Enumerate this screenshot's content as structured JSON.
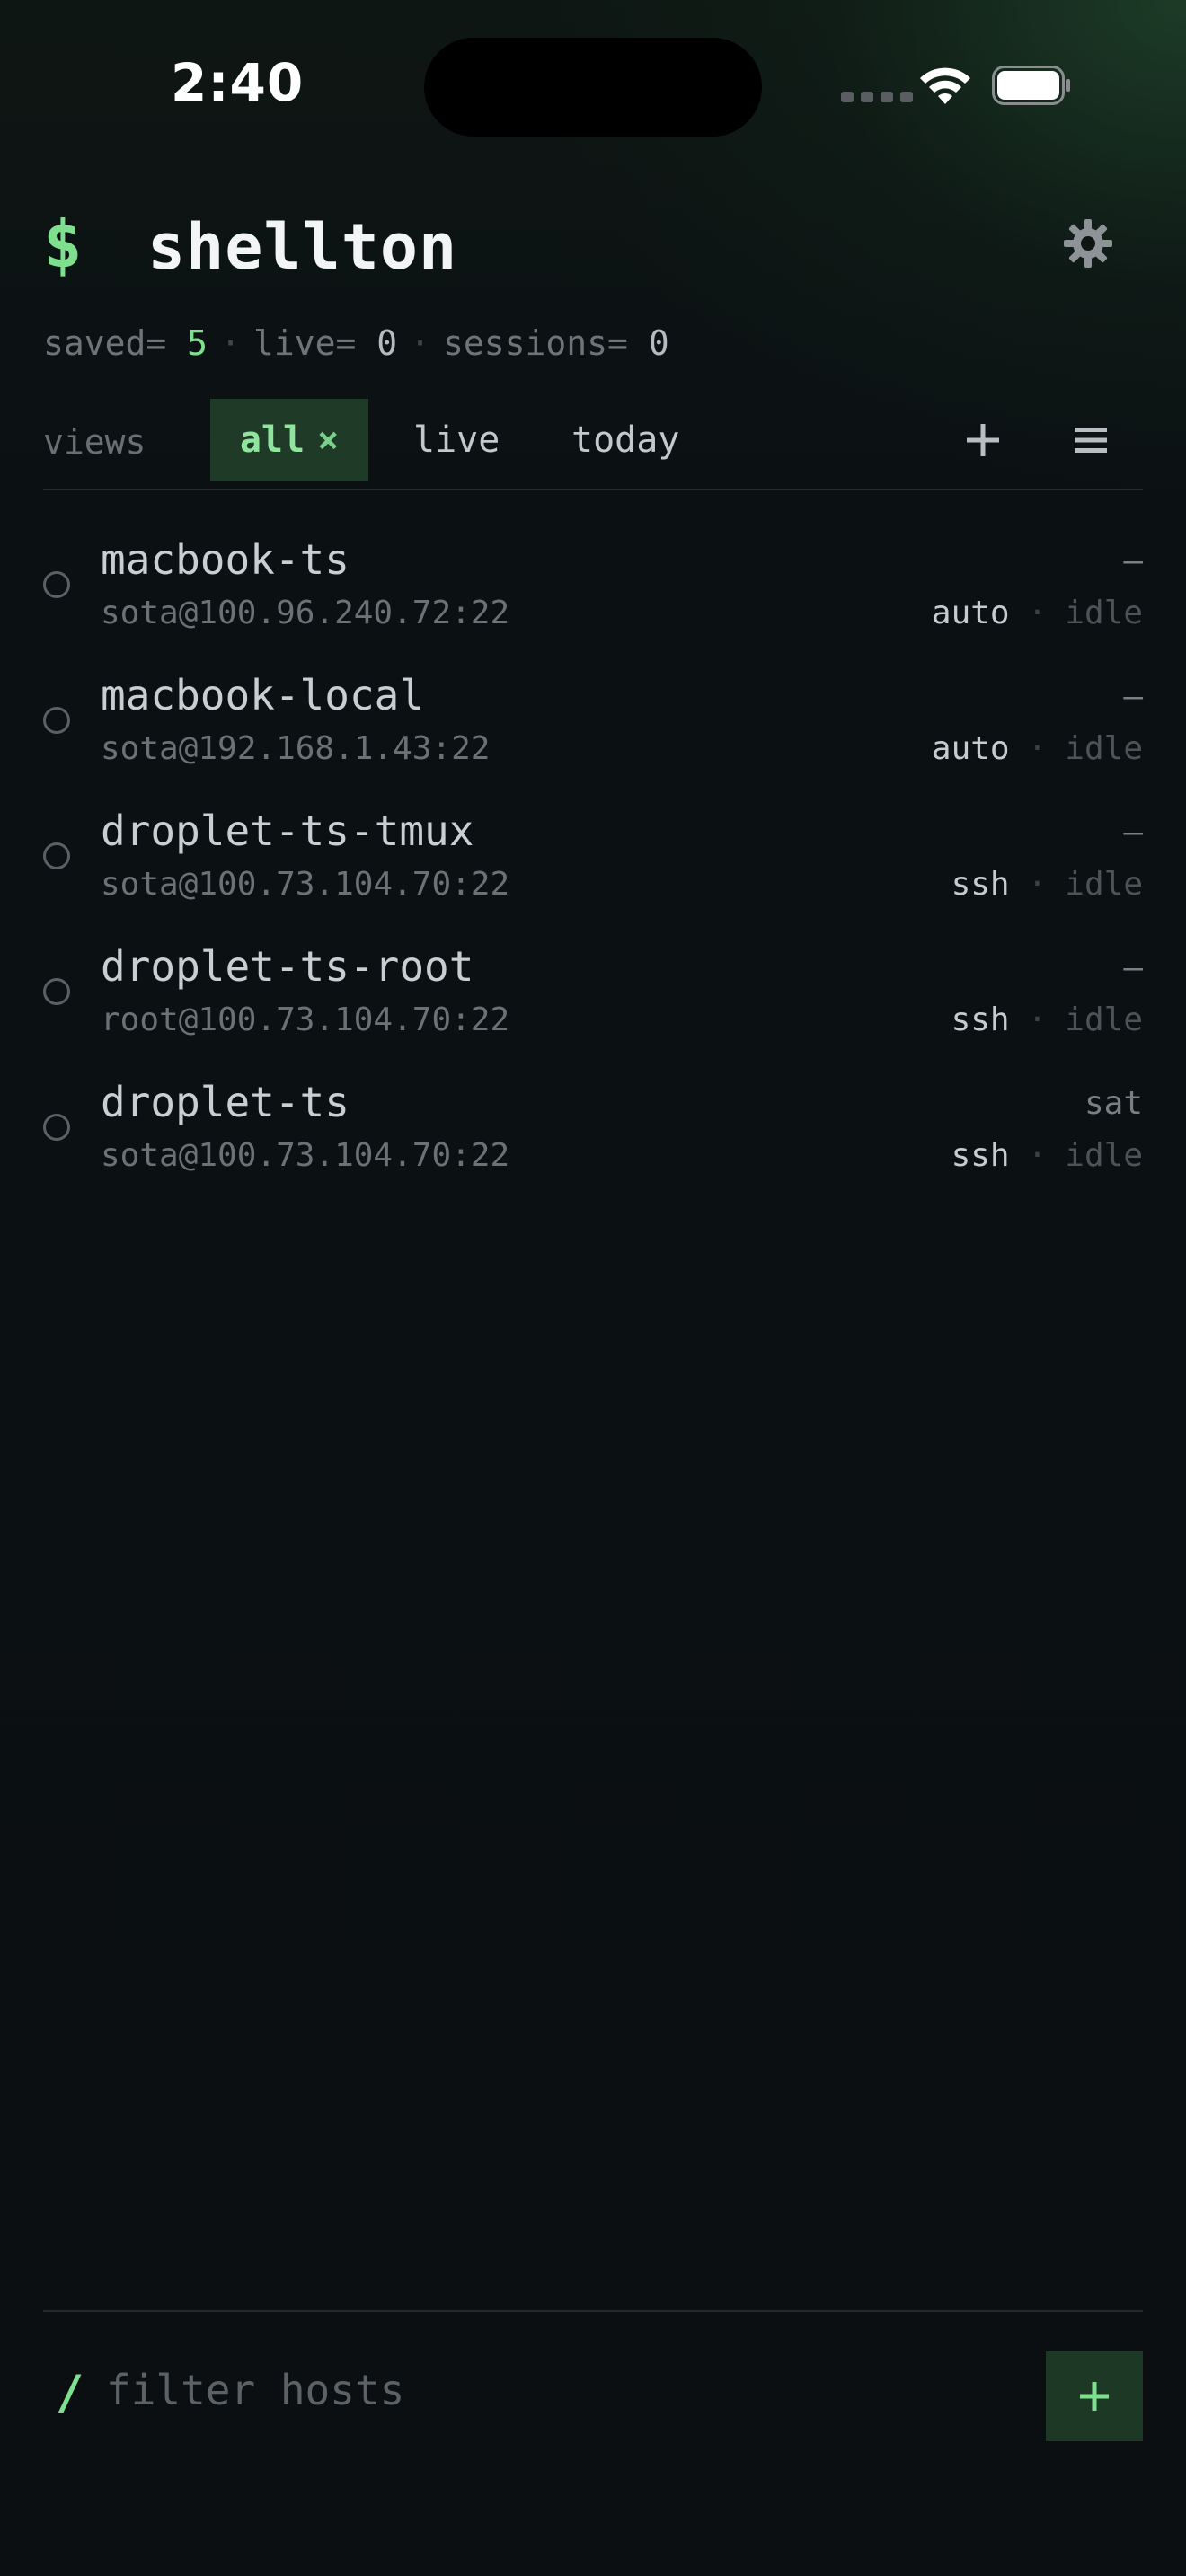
{
  "status_bar": {
    "time": "2:40"
  },
  "header": {
    "prompt_symbol": "$",
    "title": "shellton",
    "settings_icon": "gear-icon"
  },
  "stats": {
    "saved_label": "saved=",
    "saved_value": "5",
    "live_label": "live=",
    "live_value": "0",
    "sessions_label": "sessions=",
    "sessions_value": "0",
    "separator": "·"
  },
  "views": {
    "label": "views",
    "tabs": [
      {
        "label": "all",
        "active": true,
        "close_glyph": "×"
      },
      {
        "label": "live",
        "active": false
      },
      {
        "label": "today",
        "active": false
      }
    ],
    "add_icon": "plus-icon",
    "menu_icon": "menu-icon"
  },
  "hosts": [
    {
      "name": "macbook-ts",
      "address": "sota@100.96.240.72:22",
      "when": "—",
      "type": "auto",
      "status": "idle"
    },
    {
      "name": "macbook-local",
      "address": "sota@192.168.1.43:22",
      "when": "—",
      "type": "auto",
      "status": "idle"
    },
    {
      "name": "droplet-ts-tmux",
      "address": "sota@100.73.104.70:22",
      "when": "—",
      "type": "ssh",
      "status": "idle"
    },
    {
      "name": "droplet-ts-root",
      "address": "root@100.73.104.70:22",
      "when": "—",
      "type": "ssh",
      "status": "idle"
    },
    {
      "name": "droplet-ts",
      "address": "sota@100.73.104.70:22",
      "when": "sat",
      "type": "ssh",
      "status": "idle"
    }
  ],
  "host_separator": "·",
  "filter": {
    "slash": "/",
    "placeholder": "filter hosts",
    "value": "",
    "add_icon": "plus-icon"
  },
  "colors": {
    "accent": "#7ee08f",
    "accent_bg": "#203a28",
    "background": "#0b0f12"
  }
}
